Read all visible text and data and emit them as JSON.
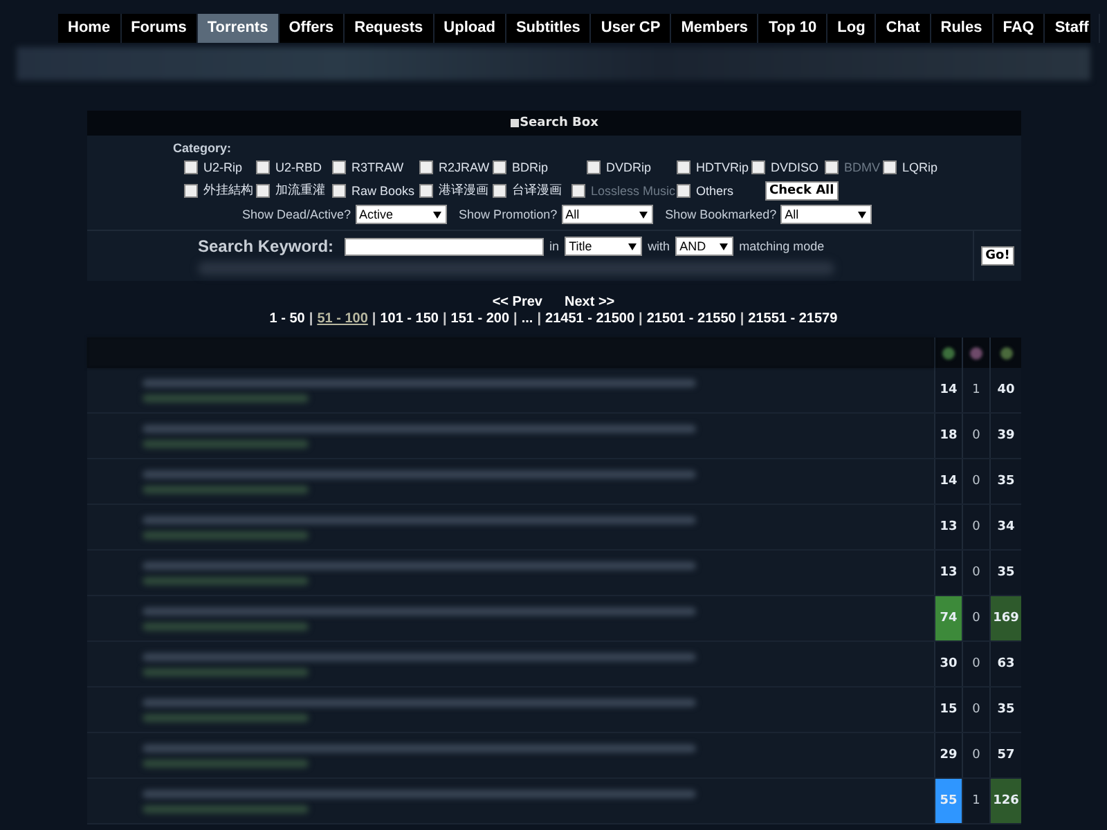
{
  "nav": [
    {
      "label": "Home",
      "selected": false
    },
    {
      "label": "Forums",
      "selected": false
    },
    {
      "label": "Torrents",
      "selected": true
    },
    {
      "label": "Offers",
      "selected": false
    },
    {
      "label": "Requests",
      "selected": false
    },
    {
      "label": "Upload",
      "selected": false
    },
    {
      "label": "Subtitles",
      "selected": false
    },
    {
      "label": "User CP",
      "selected": false
    },
    {
      "label": "Members",
      "selected": false
    },
    {
      "label": "Top 10",
      "selected": false
    },
    {
      "label": "Log",
      "selected": false
    },
    {
      "label": "Chat",
      "selected": false
    },
    {
      "label": "Rules",
      "selected": false
    },
    {
      "label": "FAQ",
      "selected": false
    },
    {
      "label": "Staff",
      "selected": false
    }
  ],
  "search_box": {
    "title": "Search Box",
    "category_label": "Category:",
    "categories": [
      [
        {
          "label": "U2-Rip",
          "checked": false,
          "disabled": false
        },
        {
          "label": "U2-RBD",
          "checked": false,
          "disabled": false
        },
        {
          "label": "R3TRAW",
          "checked": false,
          "disabled": false
        },
        {
          "label": "R2JRAW",
          "checked": false,
          "disabled": false
        },
        {
          "label": "BDRip",
          "checked": false,
          "disabled": false
        },
        {
          "label": "DVDRip",
          "checked": false,
          "disabled": false
        },
        {
          "label": "HDTVRip",
          "checked": false,
          "disabled": false
        },
        {
          "label": "DVDISO",
          "checked": false,
          "disabled": false
        },
        {
          "label": "BDMV",
          "checked": false,
          "disabled": true
        },
        {
          "label": "LQRip",
          "checked": false,
          "disabled": false
        }
      ],
      [
        {
          "label": "外挂結构",
          "checked": false,
          "disabled": false
        },
        {
          "label": "加流重灌",
          "checked": false,
          "disabled": false
        },
        {
          "label": "Raw Books",
          "checked": false,
          "disabled": false
        },
        {
          "label": "港译漫画",
          "checked": false,
          "disabled": false
        },
        {
          "label": "台译漫画",
          "checked": false,
          "disabled": false
        },
        {
          "label": "Lossless Music",
          "checked": false,
          "disabled": true
        },
        {
          "label": "Others",
          "checked": false,
          "disabled": false
        }
      ]
    ],
    "check_all": "Check All",
    "filters": [
      {
        "label": "Show Dead/Active?",
        "value": "Active"
      },
      {
        "label": "Show Promotion?",
        "value": "All"
      },
      {
        "label": "Show Bookmarked?",
        "value": "All"
      }
    ],
    "keyword_label": "Search Keyword:",
    "in_label": "in",
    "field_value": "Title",
    "with_label": "with",
    "mode_value": "AND",
    "mode_suffix": "matching mode",
    "go": "Go!"
  },
  "pager": {
    "separator": "|",
    "prev": "<< Prev",
    "next": "Next >>",
    "pages": [
      {
        "label": "1 - 50",
        "selected": false
      },
      {
        "label": "51 - 100",
        "selected": true
      },
      {
        "label": "101 - 150",
        "selected": false
      },
      {
        "label": "151 - 200",
        "selected": false
      },
      {
        "label": "...",
        "selected": false
      },
      {
        "label": "21451 - 21500",
        "selected": false
      },
      {
        "label": "21501 - 21550",
        "selected": false
      },
      {
        "label": "21551 - 21579",
        "selected": false
      }
    ]
  },
  "rows": [
    {
      "cells": [
        {
          "text": "14"
        },
        {
          "text": "1"
        },
        {
          "text": "40"
        }
      ]
    },
    {
      "cells": [
        {
          "text": "18"
        },
        {
          "text": "0"
        },
        {
          "text": "39"
        }
      ]
    },
    {
      "cells": [
        {
          "text": "14"
        },
        {
          "text": "0"
        },
        {
          "text": "35"
        }
      ]
    },
    {
      "cells": [
        {
          "text": "13"
        },
        {
          "text": "0"
        },
        {
          "text": "34"
        }
      ]
    },
    {
      "cells": [
        {
          "text": "13"
        },
        {
          "text": "0"
        },
        {
          "text": "35"
        }
      ]
    },
    {
      "cells": [
        {
          "text": "74",
          "color": "#3d8a3a"
        },
        {
          "text": "0"
        },
        {
          "text": "169",
          "color": "#2e5a2c"
        }
      ]
    },
    {
      "cells": [
        {
          "text": "30"
        },
        {
          "text": "0"
        },
        {
          "text": "63"
        }
      ]
    },
    {
      "cells": [
        {
          "text": "15"
        },
        {
          "text": "0"
        },
        {
          "text": "35"
        }
      ]
    },
    {
      "cells": [
        {
          "text": "29"
        },
        {
          "text": "0"
        },
        {
          "text": "57"
        }
      ]
    },
    {
      "cells": [
        {
          "text": "55",
          "color": "#2f96ff"
        },
        {
          "text": "1"
        },
        {
          "text": "126",
          "color": "#2e5a2c"
        }
      ]
    }
  ]
}
